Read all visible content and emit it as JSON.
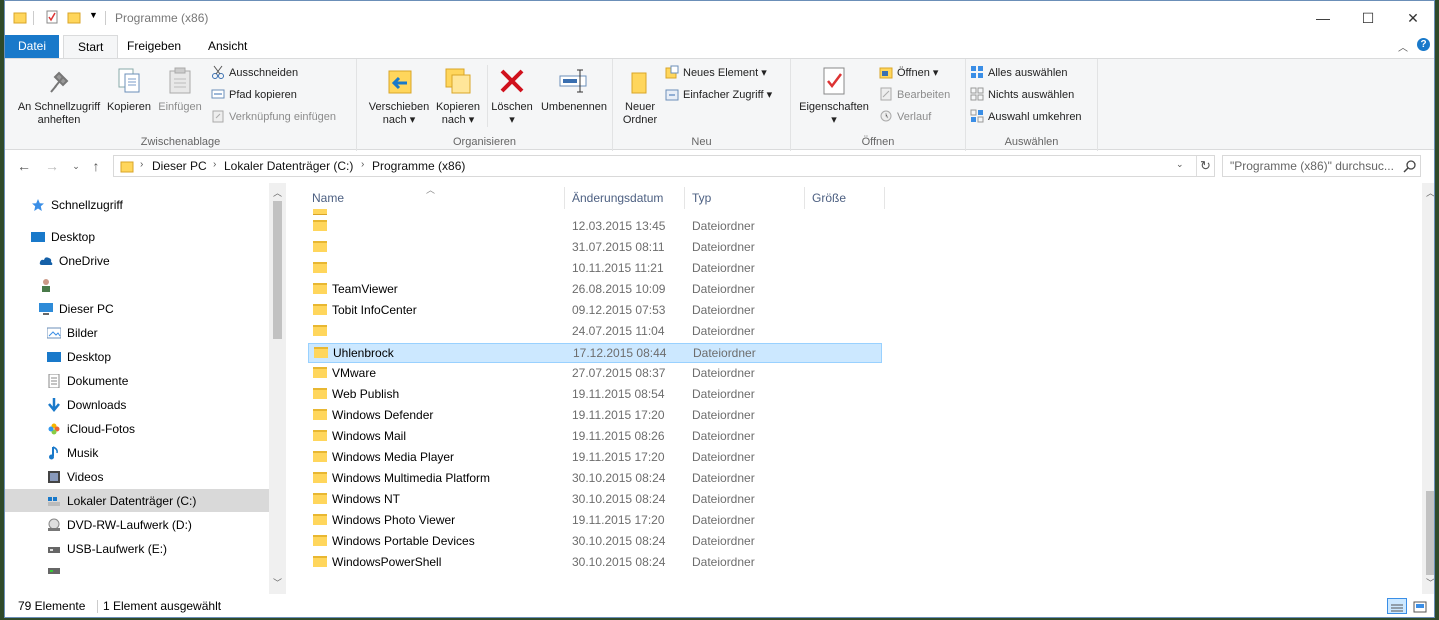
{
  "window": {
    "title": "Programme (x86)",
    "controls": {
      "minimize": "—",
      "maximize": "☐",
      "close": "✕"
    }
  },
  "tabs": [
    "Datei",
    "Start",
    "Freigeben",
    "Ansicht"
  ],
  "ribbon": {
    "clipboard": {
      "label": "Zwischenablage",
      "pin": [
        "An Schnellzugriff",
        "anheften"
      ],
      "copy": "Kopieren",
      "paste": "Einfügen",
      "cut": "Ausschneiden",
      "copy_path": "Pfad kopieren",
      "paste_link": "Verknüpfung einfügen"
    },
    "organize": {
      "label": "Organisieren",
      "move": [
        "Verschieben",
        "nach"
      ],
      "copy_to": [
        "Kopieren",
        "nach"
      ],
      "delete": "Löschen",
      "rename": "Umbenennen"
    },
    "new": {
      "label": "Neu",
      "new_folder": [
        "Neuer",
        "Ordner"
      ],
      "new_item": "Neues Element",
      "easy_access": "Einfacher Zugriff"
    },
    "open": {
      "label": "Öffnen",
      "properties": "Eigenschaften",
      "open": "Öffnen",
      "edit": "Bearbeiten",
      "history": "Verlauf"
    },
    "select": {
      "label": "Auswählen",
      "select_all": "Alles auswählen",
      "select_none": "Nichts auswählen",
      "invert": "Auswahl umkehren"
    }
  },
  "address": {
    "crumbs": [
      "Dieser PC",
      "Lokaler Datenträger (C:)",
      "Programme (x86)"
    ],
    "search_placeholder": "\"Programme (x86)\" durchsuc..."
  },
  "nav": [
    {
      "label": "Schnellzugriff",
      "icon": "star-icon"
    },
    {
      "label": "Desktop",
      "icon": "desktop-icon"
    },
    {
      "label": "OneDrive",
      "icon": "cloud-icon"
    },
    {
      "label": "",
      "icon": "user-icon"
    },
    {
      "label": "Dieser PC",
      "icon": "computer-icon"
    },
    {
      "label": "Bilder",
      "icon": "pictures-icon"
    },
    {
      "label": "Desktop",
      "icon": "desktop-icon"
    },
    {
      "label": "Dokumente",
      "icon": "documents-icon"
    },
    {
      "label": "Downloads",
      "icon": "download-icon"
    },
    {
      "label": "iCloud-Fotos",
      "icon": "icloud-photos-icon"
    },
    {
      "label": "Musik",
      "icon": "music-icon"
    },
    {
      "label": "Videos",
      "icon": "videos-icon"
    },
    {
      "label": "Lokaler Datenträger (C:)",
      "icon": "drive-icon"
    },
    {
      "label": "DVD-RW-Laufwerk (D:)",
      "icon": "dvd-icon"
    },
    {
      "label": "USB-Laufwerk (E:)",
      "icon": "usb-drive-icon"
    }
  ],
  "columns": [
    "Name",
    "Änderungsdatum",
    "Typ",
    "Größe"
  ],
  "files": [
    {
      "name": "",
      "date": "12.03.2015 13:45",
      "type": "Dateiordner"
    },
    {
      "name": "",
      "date": "31.07.2015 08:11",
      "type": "Dateiordner"
    },
    {
      "name": "",
      "date": "10.11.2015 11:21",
      "type": "Dateiordner"
    },
    {
      "name": "TeamViewer",
      "date": "26.08.2015 10:09",
      "type": "Dateiordner"
    },
    {
      "name": "Tobit InfoCenter",
      "date": "09.12.2015 07:53",
      "type": "Dateiordner"
    },
    {
      "name": "",
      "date": "24.07.2015 11:04",
      "type": "Dateiordner"
    },
    {
      "name": "Uhlenbrock",
      "date": "17.12.2015 08:44",
      "type": "Dateiordner",
      "selected": true
    },
    {
      "name": "VMware",
      "date": "27.07.2015 08:37",
      "type": "Dateiordner"
    },
    {
      "name": "Web Publish",
      "date": "19.11.2015 08:54",
      "type": "Dateiordner"
    },
    {
      "name": "Windows Defender",
      "date": "19.11.2015 17:20",
      "type": "Dateiordner"
    },
    {
      "name": "Windows Mail",
      "date": "19.11.2015 08:26",
      "type": "Dateiordner"
    },
    {
      "name": "Windows Media Player",
      "date": "19.11.2015 17:20",
      "type": "Dateiordner"
    },
    {
      "name": "Windows Multimedia Platform",
      "date": "30.10.2015 08:24",
      "type": "Dateiordner"
    },
    {
      "name": "Windows NT",
      "date": "30.10.2015 08:24",
      "type": "Dateiordner"
    },
    {
      "name": "Windows Photo Viewer",
      "date": "19.11.2015 17:20",
      "type": "Dateiordner"
    },
    {
      "name": "Windows Portable Devices",
      "date": "30.10.2015 08:24",
      "type": "Dateiordner"
    },
    {
      "name": "WindowsPowerShell",
      "date": "30.10.2015 08:24",
      "type": "Dateiordner"
    }
  ],
  "status": {
    "count": "79 Elemente",
    "selected": "1 Element ausgewählt"
  },
  "colors": {
    "accent": "#1979ca",
    "selection": "#cce8ff",
    "folder": "#ffd65c"
  }
}
